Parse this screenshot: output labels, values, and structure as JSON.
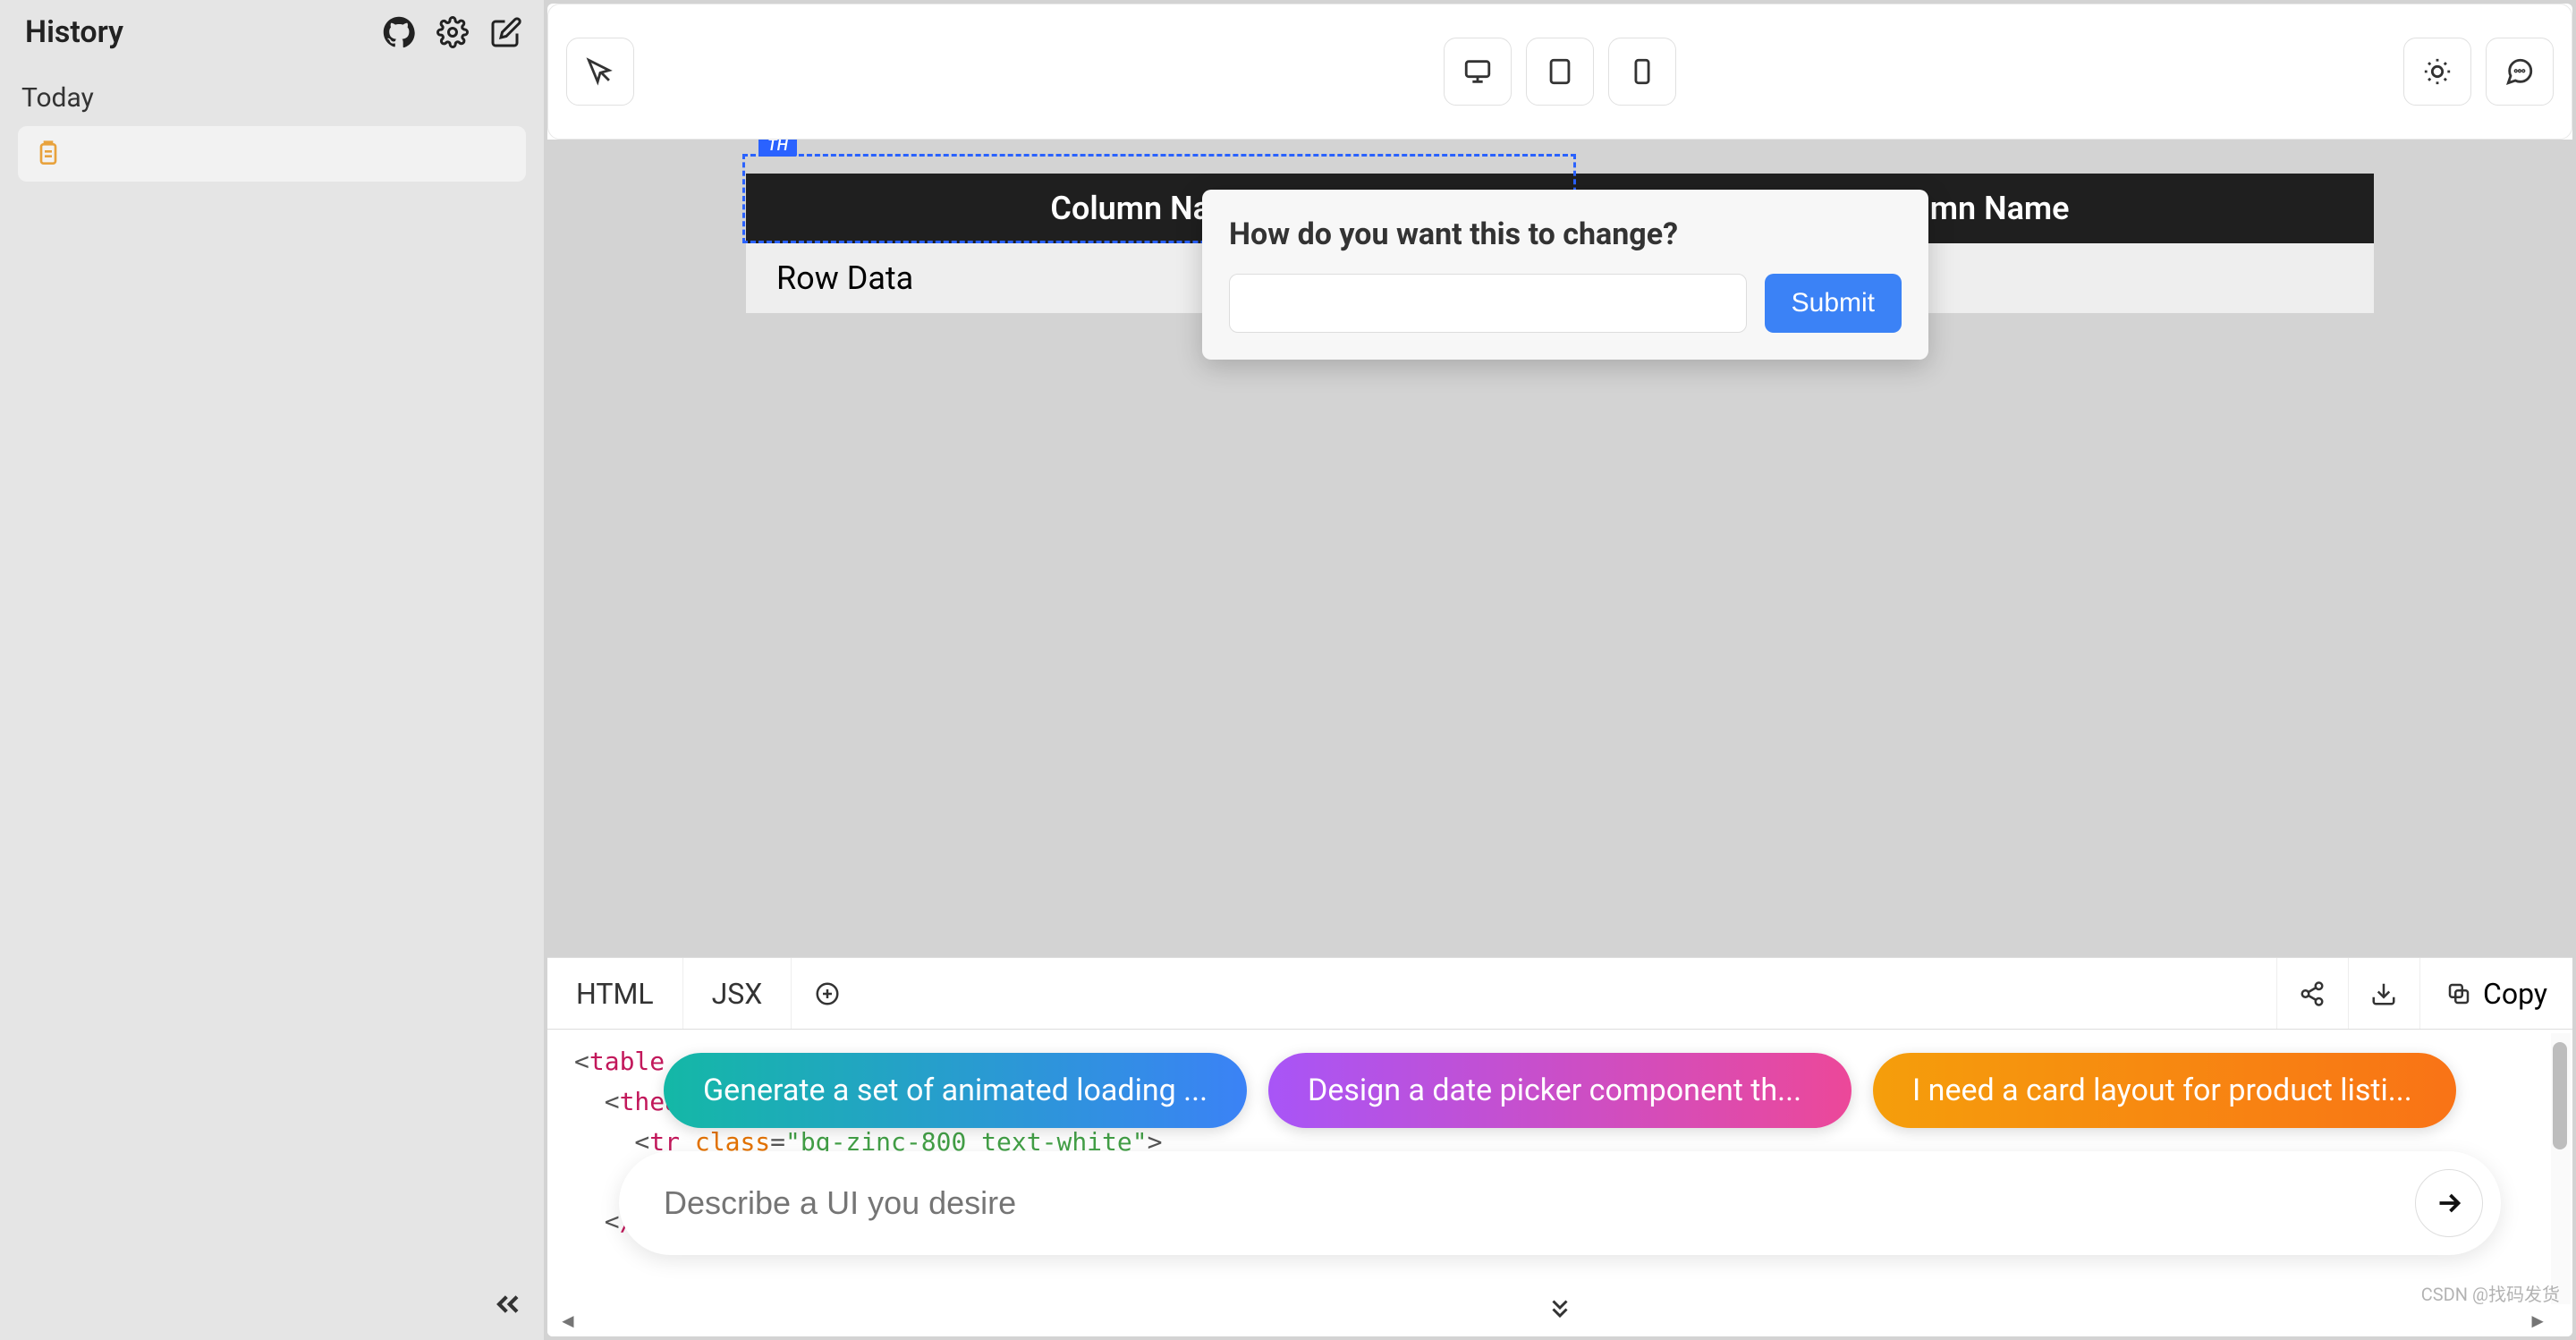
{
  "sidebar": {
    "title": "History",
    "section": "Today",
    "item_icon": "clipboard-icon"
  },
  "toolbar": {
    "cursor_icon": "cursor-click-icon",
    "desktop_icon": "desktop-icon",
    "tablet_icon": "tablet-icon",
    "mobile_icon": "mobile-icon",
    "theme_icon": "sun-icon",
    "chat_icon": "chat-icon"
  },
  "preview": {
    "selected_tag": "TH",
    "columns": [
      "Column Name",
      "Column Name"
    ],
    "row": [
      "Row Data"
    ]
  },
  "popover": {
    "title": "How do you want this to change?",
    "submit": "Submit"
  },
  "tabs": {
    "html": "HTML",
    "jsx": "JSX",
    "copy": "Copy"
  },
  "code": {
    "line1_tag": "table",
    "line2_tag": "thead",
    "line3_tag": "tr",
    "line3_attr": "class",
    "line3_val": "\"bg-zinc-800 text-white\"",
    "line5_tag": "/thead"
  },
  "suggestions": [
    "Generate a set of animated loading ...",
    "Design a date picker component th...",
    "I need a card layout for product listi..."
  ],
  "prompt": {
    "placeholder": "Describe a UI you desire"
  },
  "watermark": "CSDN @找码发货"
}
